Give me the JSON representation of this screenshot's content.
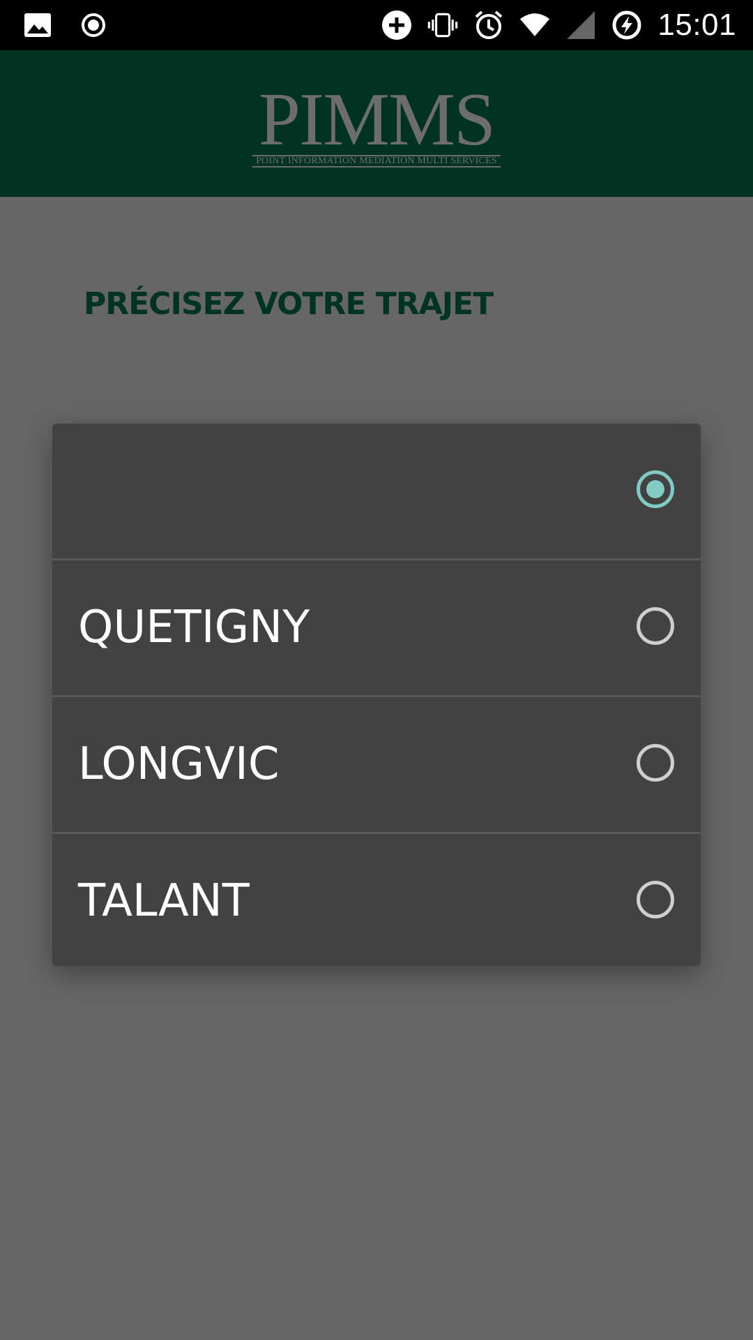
{
  "status_bar": {
    "time": "15:01",
    "icons": [
      "image-icon",
      "record-icon",
      "data-saver-icon",
      "vibrate-icon",
      "alarm-icon",
      "wifi-icon",
      "signal-icon",
      "battery-charging-icon"
    ]
  },
  "header": {
    "logo_text": "PIMMS",
    "logo_subtitle": "POINT INFORMATION MEDIATION MULTI SERVICES",
    "background": "#003322"
  },
  "page": {
    "heading": "PRÉCISEZ VOTRE TRAJET"
  },
  "dialog": {
    "options": [
      {
        "label": "",
        "selected": true
      },
      {
        "label": "QUETIGNY",
        "selected": false
      },
      {
        "label": "LONGVIC",
        "selected": false
      },
      {
        "label": "TALANT",
        "selected": false
      }
    ],
    "accent": "#80cbc4"
  }
}
